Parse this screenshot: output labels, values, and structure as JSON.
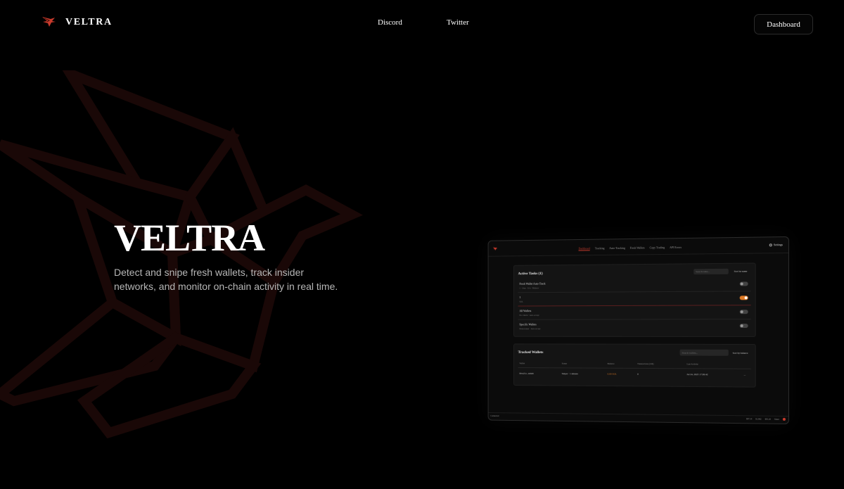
{
  "brand": {
    "name": "VELTRA"
  },
  "nav": {
    "discord": "Discord",
    "twitter": "Twitter",
    "dashboard": "Dashboard"
  },
  "hero": {
    "title": "VELTRA",
    "subtitle": "Detect and snipe fresh wallets, track insider networks, and monitor on-chain activity in real time."
  },
  "colors": {
    "accent": "#c83a2c",
    "toggle_on": "#e07a24",
    "background": "#000000"
  },
  "preview": {
    "tabs": [
      {
        "label": "Dashboard",
        "active": true
      },
      {
        "label": "Tracking",
        "active": false
      },
      {
        "label": "Auto-Tracking",
        "active": false
      },
      {
        "label": "Fresh Wallets",
        "active": false
      },
      {
        "label": "Copy Trading",
        "active": false
      },
      {
        "label": "API Errors",
        "active": false
      }
    ],
    "settings": "Settings",
    "active_tasks": {
      "title": "Active Tasks (1)",
      "search_placeholder": "Search tasks...",
      "sort": "Sort by name",
      "tasks": [
        {
          "name": "Fresh Wallet Auto-Track",
          "meta": "1 · 1day · 0.1s · Balance",
          "on": false
        },
        {
          "name": "1",
          "meta": "SOL",
          "on": true
        },
        {
          "name": "All Wallets",
          "meta": "No criteria · Auto-accept",
          "on": false
        },
        {
          "name": "Specific Wallets",
          "meta": "Dexscreener · Auto-accept",
          "on": false
        }
      ]
    },
    "tracked_wallets": {
      "title": "Tracked Wallets",
      "search_placeholder": "Search wallets...",
      "sort": "Sort by balance",
      "columns": [
        "Wallet",
        "Status",
        "Balance",
        "Transactions (24h)",
        "Last Activity"
      ],
      "rows": [
        {
          "wallet": "9bwZ1r...m4n6",
          "status": "Sniper · 1 minute",
          "balance": "0.00 SOL",
          "transactions": "0",
          "last_activity": "Jul 24, 2025 17:38:42",
          "action": "..."
        }
      ]
    },
    "status": {
      "left": "Connected",
      "sol": "$97.19",
      "eth": "$1,962",
      "btc": "$91.20",
      "share": "Share"
    }
  }
}
